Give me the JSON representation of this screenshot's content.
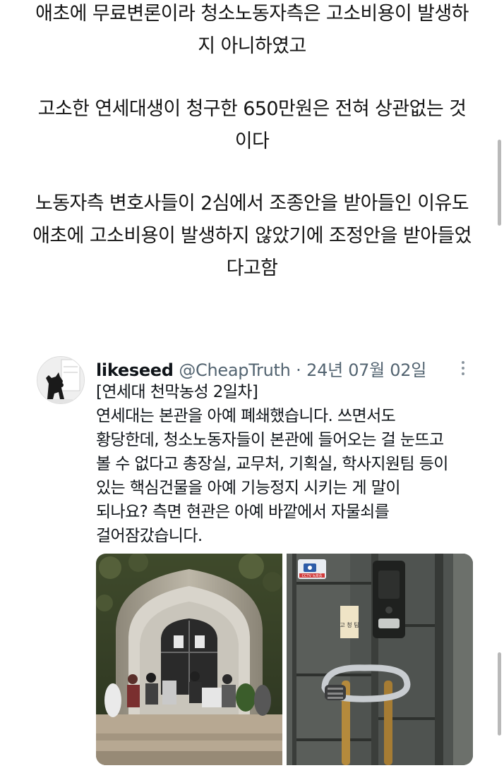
{
  "article": {
    "paragraphs": [
      [
        "애초에 무료변론이라 청소노동자측은 고소비용이 발생하",
        "지 아니하였고"
      ],
      [
        "고소한 연세대생이 청구한 650만원은 전혀 상관없는 것",
        "이다"
      ],
      [
        "노동자측 변호사들이 2심에서 조종안을 받아들인 이유도",
        "애초에 고소비용이 발생하지 않았기에 조정안을 받아들었",
        "다고함"
      ]
    ]
  },
  "tweet": {
    "display_name": "likeseed",
    "handle": "@CheapTruth",
    "separator": "·",
    "date": "24년 07월 02일",
    "more_icon": "more-vertical-icon",
    "body_lines": [
      "[연세대 천막농성 2일차]",
      "연세대는 본관을 아예 폐쇄했습니다. 쓰면서도",
      "황당한데, 청소노동자들이 본관에 들어오는 걸 눈뜨고",
      "볼 수 없다고 총장실, 교무처, 기획실, 학사지원팀 등이",
      "있는 핵심건물을 아예 기능정지 시키는 게 말이",
      "되나요? 측면 현관은 아예 바깥에서 자물쇠를",
      "걸어잠갔습니다."
    ],
    "photos": {
      "left_alt": "campus-building-entrance-photo",
      "right_alt": "locked-door-photo",
      "door_plate": "고 청 팀",
      "cctv_label": "CCTV 녹화중"
    }
  },
  "colors": {
    "text": "#141414",
    "secondary": "#536471",
    "scrollbar": "#b9b9b9"
  }
}
